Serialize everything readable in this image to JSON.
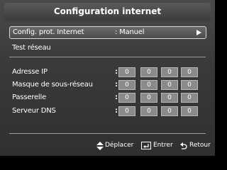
{
  "window": {
    "title": "Configuration internet"
  },
  "menu": {
    "protocol": {
      "label": "Config. prot. Internet",
      "value": ": Manuel"
    },
    "test": {
      "label": "Test réseau"
    }
  },
  "fields": [
    {
      "label": "Adresse IP",
      "colon": ":",
      "octets": [
        "0",
        "0",
        "0",
        "0"
      ]
    },
    {
      "label": "Masque de sous-réseau",
      "colon": ":",
      "octets": [
        "0",
        "0",
        "0",
        "0"
      ]
    },
    {
      "label": "Passerelle",
      "colon": ":",
      "octets": [
        "0",
        "0",
        "0",
        "0"
      ]
    },
    {
      "label": "Serveur DNS",
      "colon": ":",
      "octets": [
        "0",
        "0",
        "0",
        "0"
      ]
    }
  ],
  "footer": {
    "move": {
      "icon": "up-down-arrows-icon",
      "label": "Déplacer"
    },
    "enter": {
      "icon": "enter-icon",
      "label": "Entrer"
    },
    "return": {
      "icon": "return-icon",
      "label": "Retour"
    }
  }
}
